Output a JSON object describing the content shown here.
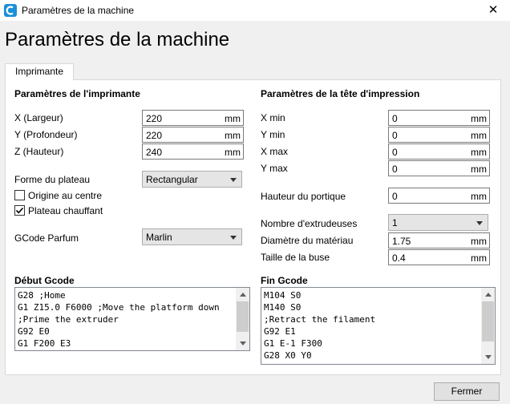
{
  "window": {
    "title": "Paramètres de la machine",
    "close_glyph": "✕"
  },
  "page": {
    "title": "Paramètres de la machine"
  },
  "tabs": [
    {
      "label": "Imprimante"
    }
  ],
  "printer": {
    "section_title": "Paramètres de l'imprimante",
    "width": {
      "label": "X (Largeur)",
      "value": "220",
      "unit": "mm"
    },
    "depth": {
      "label": "Y (Profondeur)",
      "value": "220",
      "unit": "mm"
    },
    "height": {
      "label": "Z (Hauteur)",
      "value": "240",
      "unit": "mm"
    },
    "build_plate": {
      "label": "Forme du plateau",
      "value": "Rectangular"
    },
    "origin_center": {
      "label": "Origine au centre",
      "checked": false
    },
    "heated_bed": {
      "label": "Plateau chauffant",
      "checked": true
    },
    "gcode_flavor": {
      "label": "GCode Parfum",
      "value": "Marlin"
    }
  },
  "printhead": {
    "section_title": "Paramètres de la tête d'impression",
    "x_min": {
      "label": "X min",
      "value": "0",
      "unit": "mm"
    },
    "y_min": {
      "label": "Y min",
      "value": "0",
      "unit": "mm"
    },
    "x_max": {
      "label": "X max",
      "value": "0",
      "unit": "mm"
    },
    "y_max": {
      "label": "Y max",
      "value": "0",
      "unit": "mm"
    },
    "gantry_height": {
      "label": "Hauteur du portique",
      "value": "0",
      "unit": "mm"
    },
    "extruder_count": {
      "label": "Nombre d'extrudeuses",
      "value": "1"
    },
    "material_diameter": {
      "label": "Diamètre du matériau",
      "value": "1.75",
      "unit": "mm"
    },
    "nozzle_size": {
      "label": "Taille de la buse",
      "value": "0.4",
      "unit": "mm"
    }
  },
  "start_gcode": {
    "label": "Début Gcode",
    "lines": [
      "G28 ;Home",
      "G1 Z15.0 F6000 ;Move the platform down",
      ";Prime the extruder",
      "G92 E0",
      "G1 F200 E3"
    ]
  },
  "end_gcode": {
    "label": "Fin Gcode",
    "lines": [
      "M104 S0",
      "M140 S0",
      ";Retract the filament",
      "G92 E1",
      "G1 E-1 F300",
      "G28 X0 Y0"
    ]
  },
  "footer": {
    "close_label": "Fermer"
  },
  "colors": {
    "app_icon": "#1b8fd8",
    "panel_border": "#d9d9d9"
  },
  "icons": {
    "app": "cura-logo-icon",
    "close": "close-icon",
    "check": "checkmark-icon"
  }
}
